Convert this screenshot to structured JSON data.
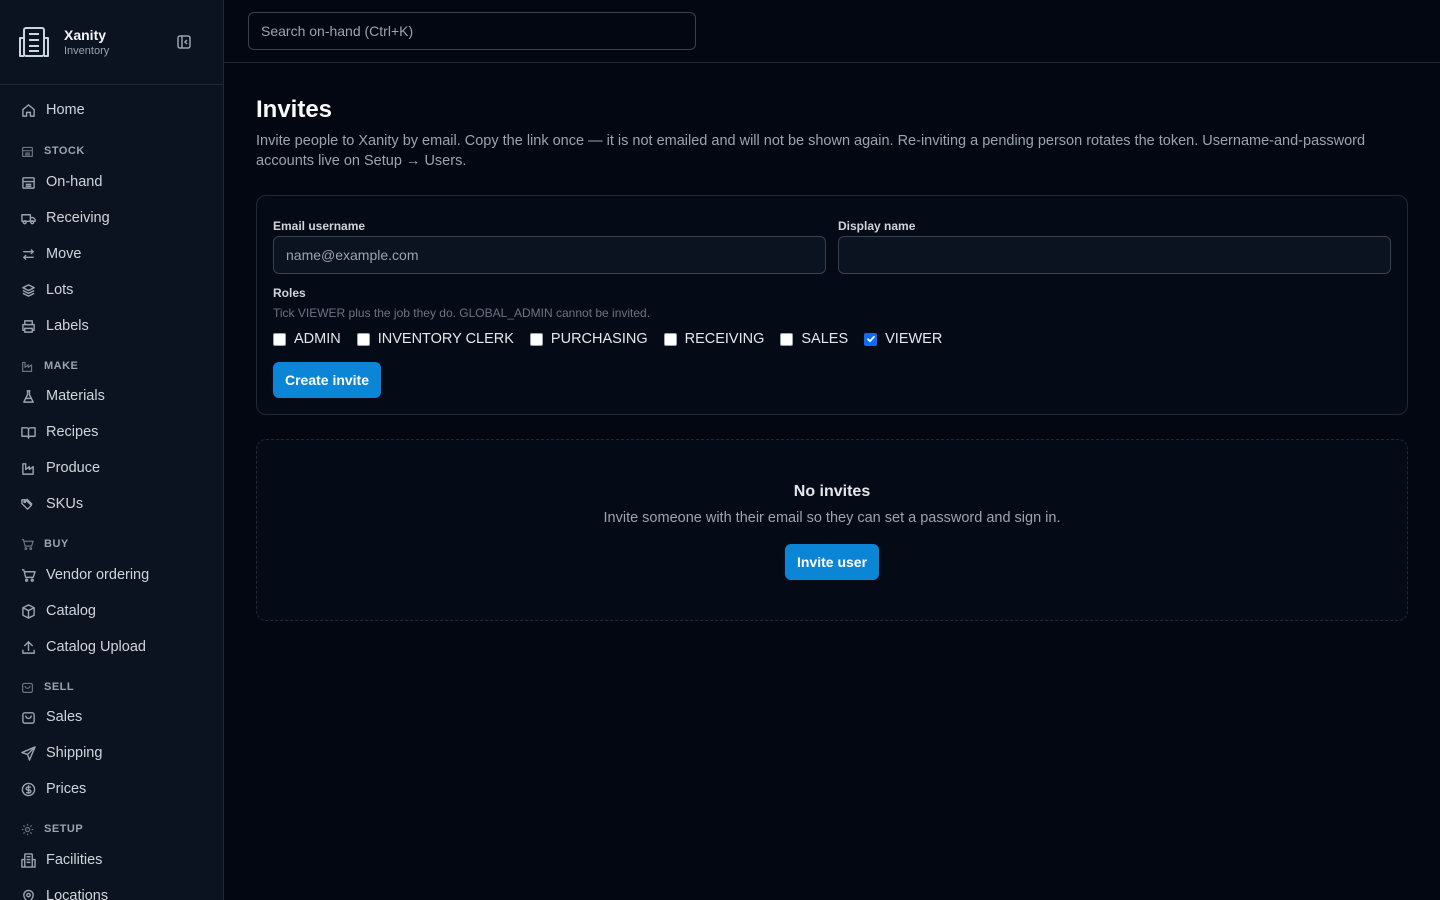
{
  "brand": {
    "name": "Xanity",
    "subtitle": "Inventory"
  },
  "search": {
    "placeholder": "Search on-hand (Ctrl+K)"
  },
  "sidebar": {
    "home": "Home",
    "sections": {
      "stock": "STOCK",
      "make": "MAKE",
      "buy": "BUY",
      "sell": "SELL",
      "setup": "SETUP"
    },
    "items": {
      "on_hand": "On-hand",
      "receiving": "Receiving",
      "move": "Move",
      "lots": "Lots",
      "labels": "Labels",
      "materials": "Materials",
      "recipes": "Recipes",
      "produce": "Produce",
      "skus": "SKUs",
      "vendor_ordering": "Vendor ordering",
      "catalog": "Catalog",
      "catalog_upload": "Catalog Upload",
      "sales": "Sales",
      "shipping": "Shipping",
      "prices": "Prices",
      "facilities": "Facilities",
      "locations": "Locations"
    }
  },
  "main": {
    "title": "Invites",
    "description": "Invite people to Xanity by email. Copy the link once — it is not emailed and will not be shown again. Re-inviting a pending person rotates the token. Username-and-password accounts live on Setup → Users.",
    "form": {
      "email_label": "Email username",
      "email_placeholder": "name@example.com",
      "email_value": "",
      "display_label": "Display name",
      "display_value": "",
      "roles_label": "Roles",
      "roles_hint": "Tick VIEWER plus the job they do. GLOBAL_ADMIN cannot be invited.",
      "roles": [
        {
          "label": "ADMIN",
          "checked": false
        },
        {
          "label": "INVENTORY CLERK",
          "checked": false
        },
        {
          "label": "PURCHASING",
          "checked": false
        },
        {
          "label": "RECEIVING",
          "checked": false
        },
        {
          "label": "SALES",
          "checked": false
        },
        {
          "label": "VIEWER",
          "checked": true
        }
      ],
      "submit_label": "Create invite"
    },
    "empty": {
      "title": "No invites",
      "description": "Invite someone with their email so they can set a password and sign in.",
      "button_label": "Invite user"
    }
  },
  "colors": {
    "accent": "#0b86d6",
    "checkbox": "#0a6cff",
    "background": "#030712",
    "sidebar": "#0b1220"
  }
}
